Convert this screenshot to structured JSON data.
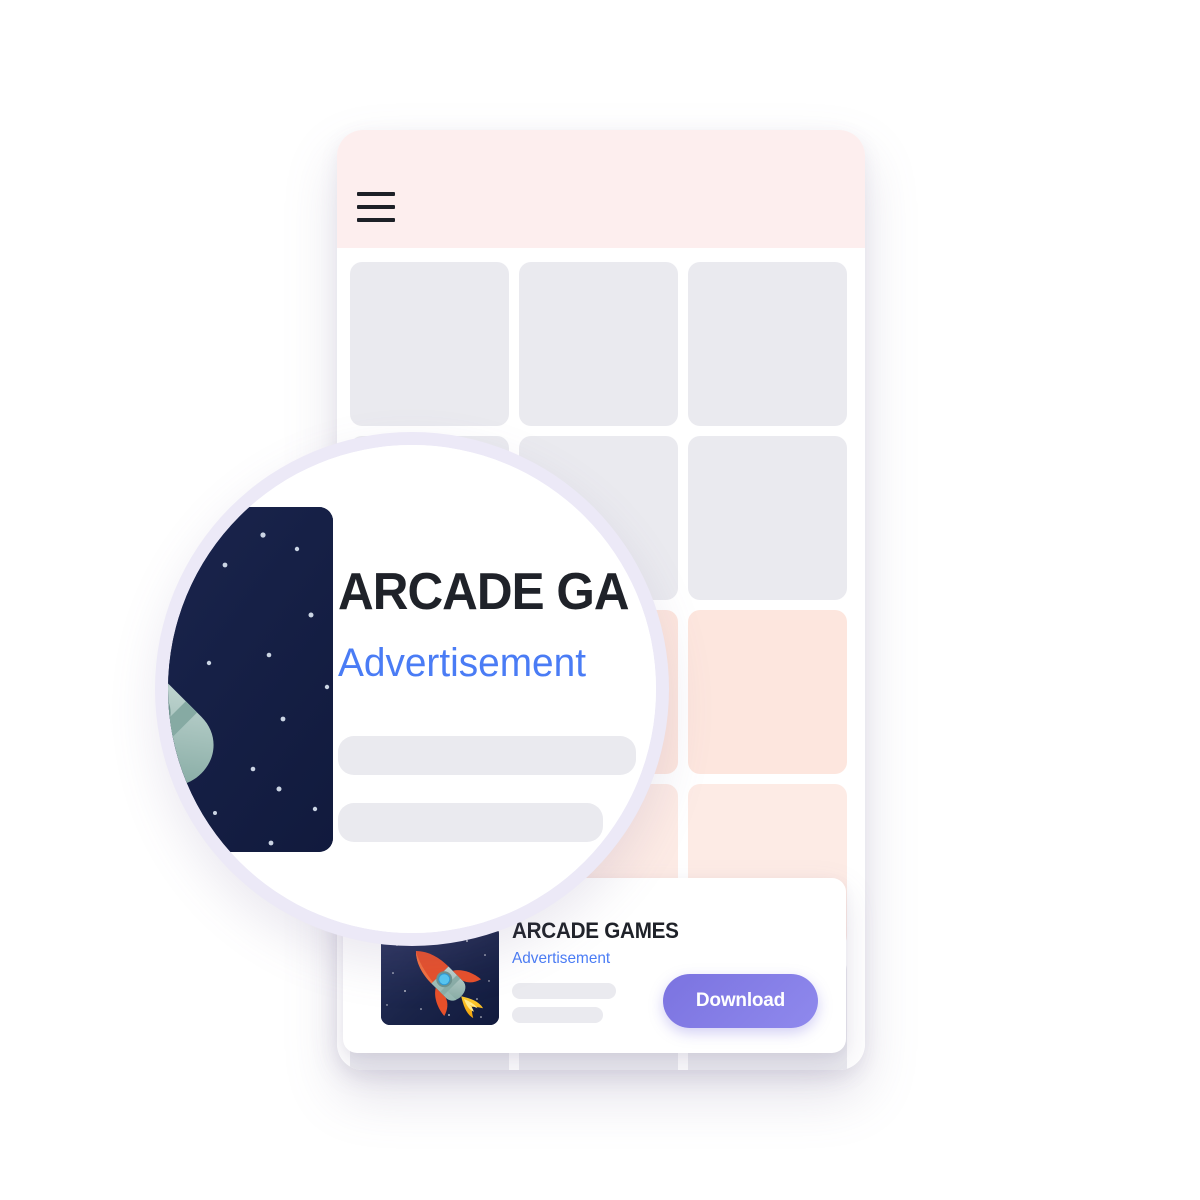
{
  "app": {
    "header": {
      "menu_icon": "hamburger-menu-icon",
      "background_color": "#fdeeee"
    },
    "content_grid": {
      "columns": 3,
      "cells": [
        {
          "id": "cell-1",
          "tone": "gray",
          "color": "#eaeaef"
        },
        {
          "id": "cell-2",
          "tone": "gray",
          "color": "#eaeaef"
        },
        {
          "id": "cell-3",
          "tone": "gray",
          "color": "#eaeaef"
        },
        {
          "id": "cell-4",
          "tone": "gray",
          "color": "#eaeaef"
        },
        {
          "id": "cell-5",
          "tone": "gray",
          "color": "#eaeaef"
        },
        {
          "id": "cell-6",
          "tone": "gray",
          "color": "#eaeaef"
        },
        {
          "id": "cell-7",
          "tone": "peach",
          "color": "#fde6de"
        },
        {
          "id": "cell-8",
          "tone": "peach",
          "color": "#fde6de"
        },
        {
          "id": "cell-9",
          "tone": "peach",
          "color": "#fde6de"
        },
        {
          "id": "cell-10",
          "tone": "peach2",
          "color": "#fdebe5"
        },
        {
          "id": "cell-11",
          "tone": "peach2",
          "color": "#fdebe5"
        },
        {
          "id": "cell-12",
          "tone": "peach2",
          "color": "#fdebe5"
        },
        {
          "id": "cell-13",
          "tone": "gray",
          "color": "#eaeaef"
        },
        {
          "id": "cell-14",
          "tone": "gray",
          "color": "#eaeaef"
        },
        {
          "id": "cell-15",
          "tone": "gray",
          "color": "#eaeaef"
        }
      ]
    },
    "ad_banner": {
      "title": "ARCADE GAMES",
      "subtitle": "Advertisement",
      "cta_label": "Download",
      "thumbnail_icon": "rocket-icon",
      "title_color": "#1f2229",
      "subtitle_color": "#4a7cf5",
      "cta_color": "#7b73e0"
    }
  },
  "magnifier": {
    "title": "ARCADE GA",
    "subtitle": "Advertisement",
    "thumbnail_icon": "rocket-icon",
    "ring_color": "#e9e6f6"
  }
}
